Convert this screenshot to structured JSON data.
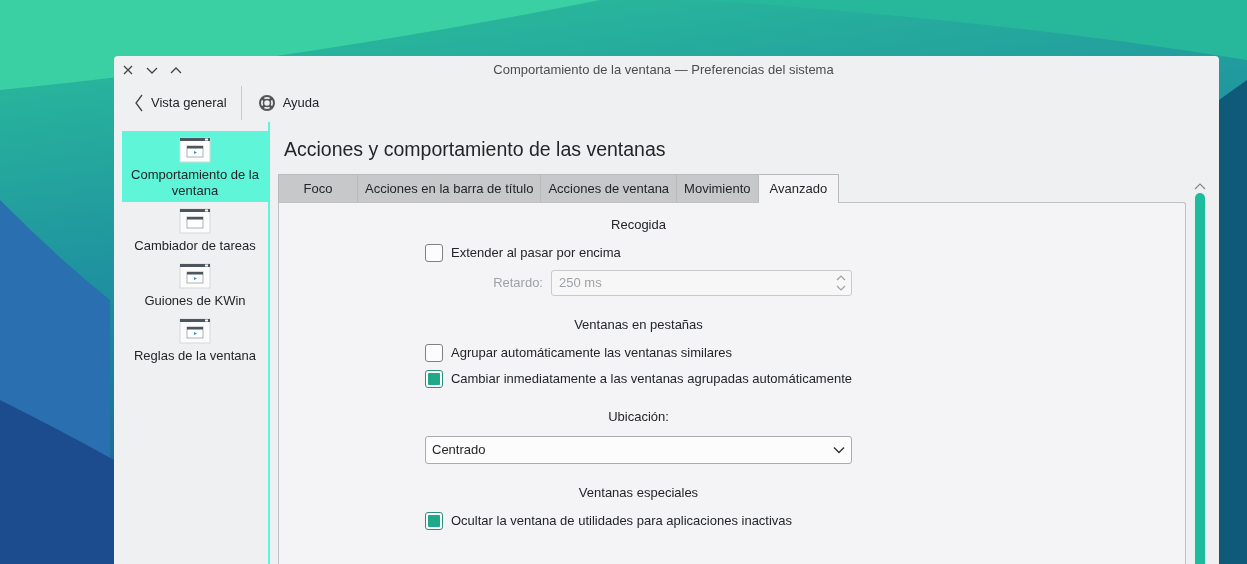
{
  "window": {
    "title": "Comportamiento de la ventana  — Preferencias del sistema"
  },
  "toolbar": [
    {
      "kind": "back",
      "label": "Vista general"
    },
    {
      "kind": "help",
      "label": "Ayuda"
    }
  ],
  "sidebar": {
    "items": [
      {
        "label": "Comportamiento de la ventana",
        "kind": "play",
        "selected": true
      },
      {
        "label": "Cambiador de tareas",
        "kind": "plain",
        "selected": false
      },
      {
        "label": "Guiones de KWin",
        "kind": "play",
        "selected": false
      },
      {
        "label": "Reglas de la ventana",
        "kind": "play",
        "selected": false
      }
    ]
  },
  "page": {
    "title": "Acciones y comportamiento de las ventanas"
  },
  "tabs": [
    {
      "label": "Foco",
      "selected": false
    },
    {
      "label": "Acciones en la barra de título",
      "selected": false
    },
    {
      "label": "Acciones de ventana",
      "selected": false
    },
    {
      "label": "Movimiento",
      "selected": false
    },
    {
      "label": "Avanzado",
      "selected": true
    }
  ],
  "groups": [
    {
      "heading": "Recogida",
      "rows": [
        {
          "kind": "checkbox",
          "label": "Extender al pasar por encima",
          "checked": false
        },
        {
          "kind": "spinbox",
          "label": "Retardo:",
          "value": "250 ms",
          "disabled": true
        }
      ]
    },
    {
      "heading": "Ventanas en pestañas",
      "rows": [
        {
          "kind": "checkbox",
          "label": "Agrupar automáticamente las ventanas similares",
          "checked": false
        },
        {
          "kind": "checkbox",
          "label": "Cambiar inmediatamente a las ventanas agrupadas automáticamente",
          "checked": true
        }
      ]
    },
    {
      "heading": "Ubicación:",
      "rows": [
        {
          "kind": "combo",
          "value": "Centrado"
        }
      ]
    },
    {
      "heading": "Ventanas especiales",
      "rows": [
        {
          "kind": "checkbox",
          "label": "Ocultar la ventana de utilidades para aplicaciones inactivas",
          "checked": true
        }
      ]
    }
  ]
}
